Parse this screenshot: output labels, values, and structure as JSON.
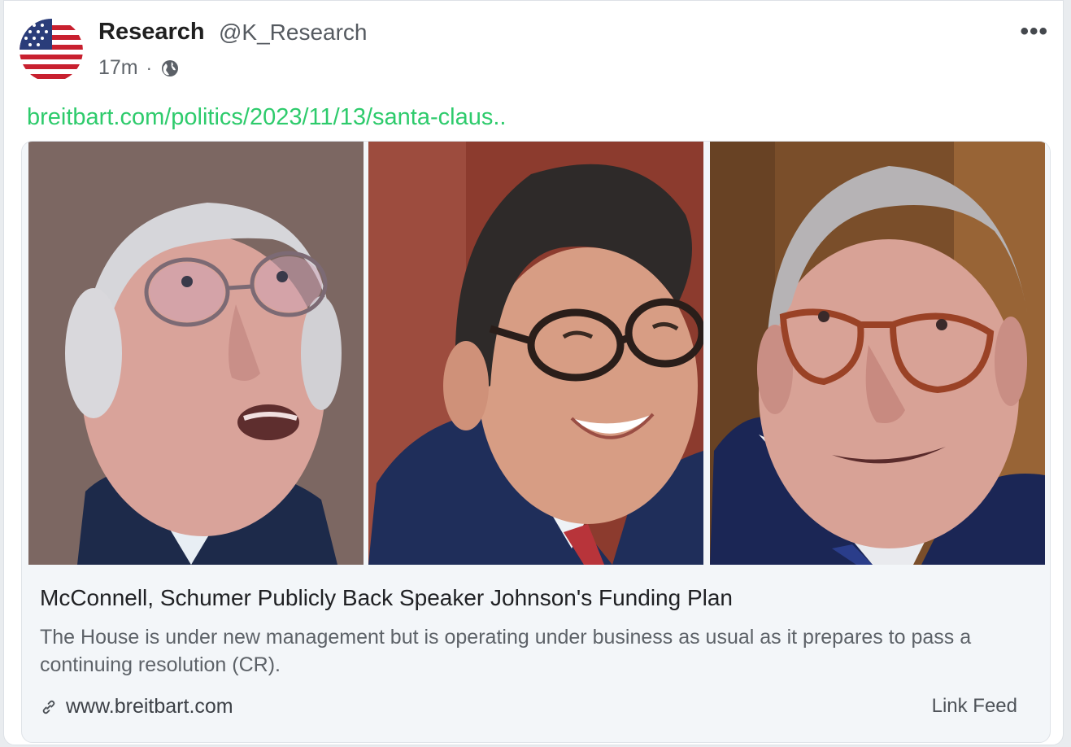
{
  "author": {
    "name": "Research",
    "handle": "@K_Research",
    "time": "17m",
    "separator": "·",
    "avatar_icon": "us-flag-icon",
    "visibility_icon": "globe-icon"
  },
  "menu": {
    "more_label": "•••"
  },
  "post": {
    "link_text": "breitbart.com/politics/2023/11/13/santa-claus.."
  },
  "card": {
    "title": "McConnell, Schumer Publicly Back Speaker Johnson's Funding Plan",
    "description": "The House is under new management but is operating under business as usual as it prepares to pass a continuing resolution (CR).",
    "domain": "www.breitbart.com",
    "feed_label": "Link Feed"
  },
  "colors": {
    "link_green": "#2ecb6c",
    "card_bg": "#f3f6f9"
  }
}
